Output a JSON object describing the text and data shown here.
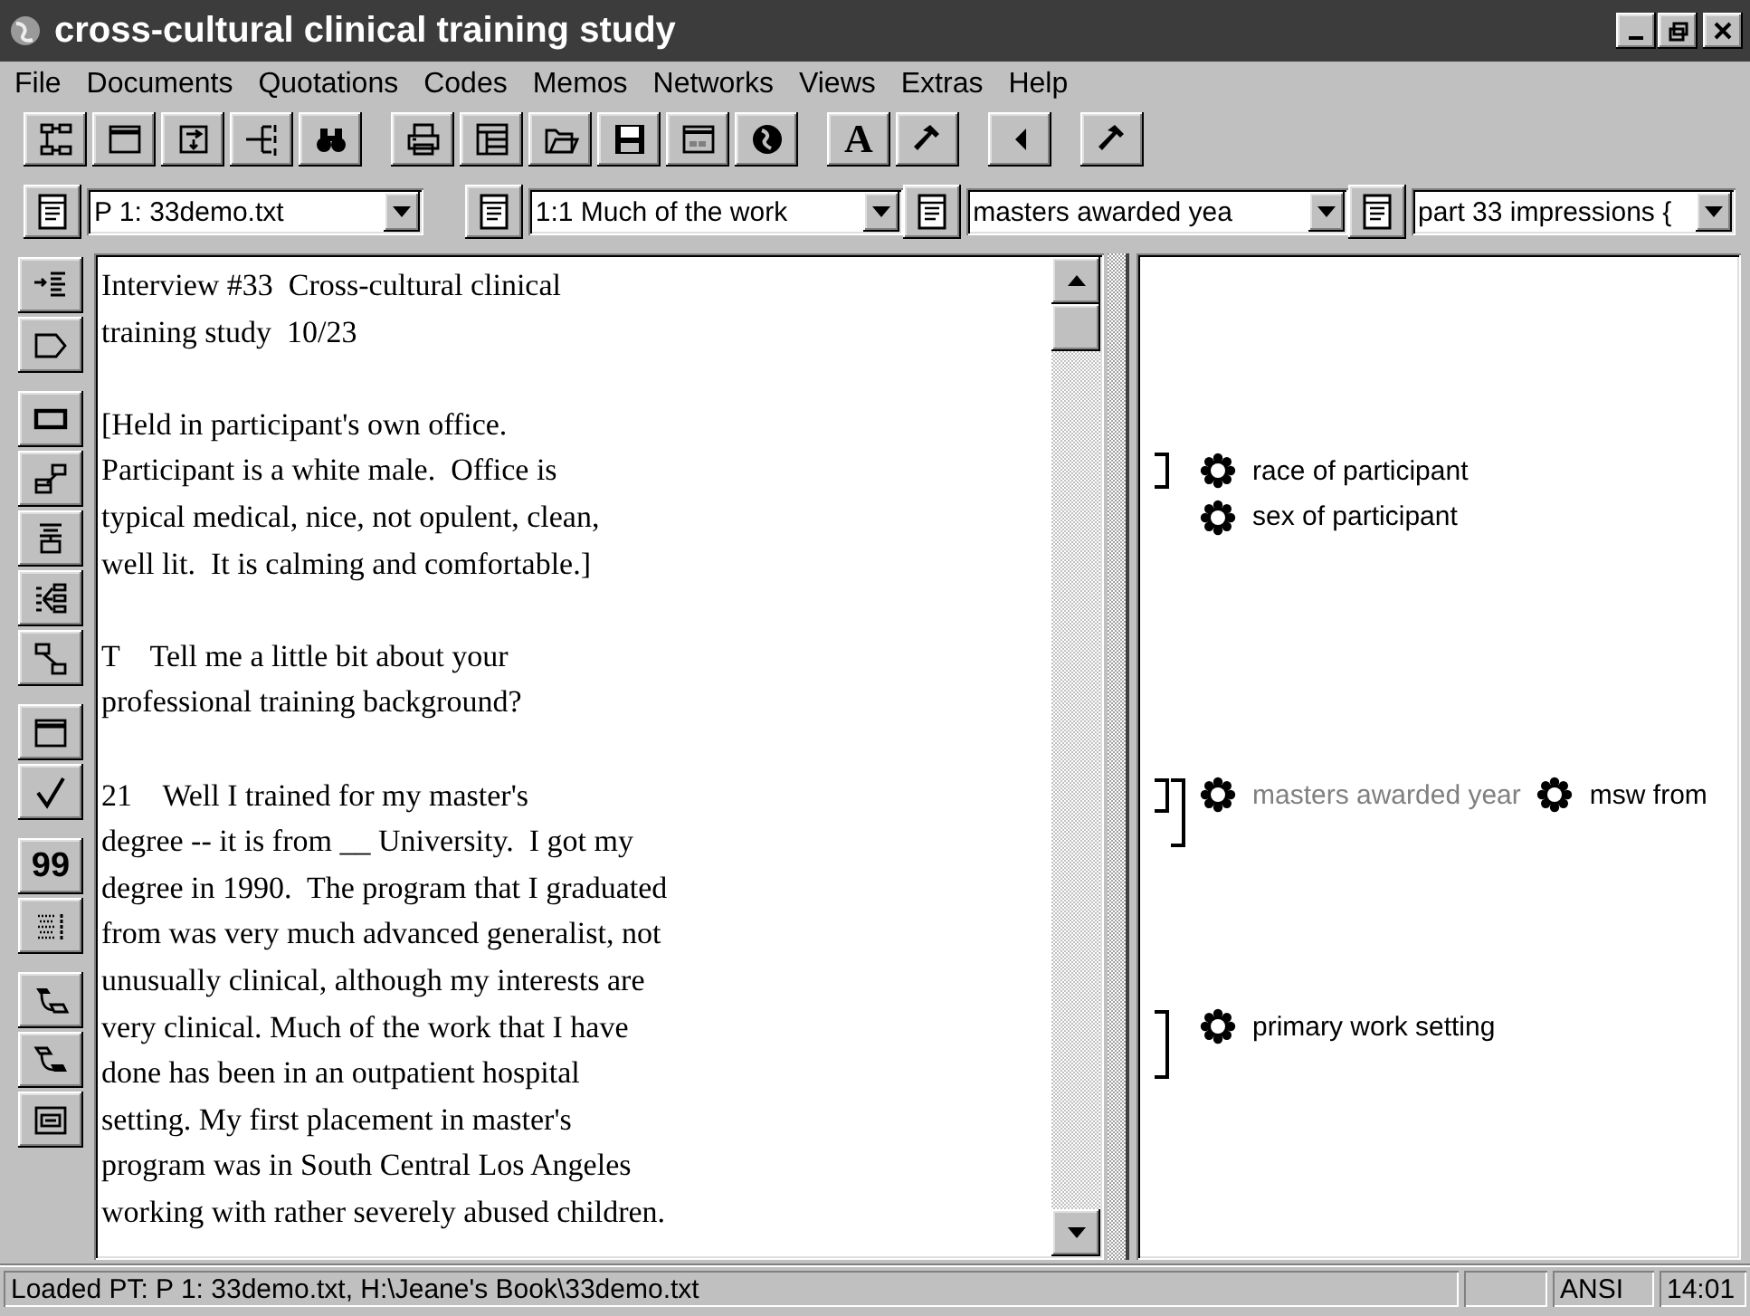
{
  "window": {
    "title": "cross-cultural clinical training study"
  },
  "menu": [
    "File",
    "Documents",
    "Quotations",
    "Codes",
    "Memos",
    "Networks",
    "Views",
    "Extras",
    "Help"
  ],
  "toolbar": [
    [
      {
        "kind": "hierarchy"
      },
      {
        "kind": "window"
      },
      {
        "kind": "import"
      },
      {
        "kind": "branch"
      },
      {
        "kind": "binoculars"
      }
    ],
    [
      {
        "kind": "printer"
      },
      {
        "kind": "table"
      },
      {
        "kind": "folder"
      },
      {
        "kind": "floppy"
      },
      {
        "kind": "panel"
      },
      {
        "kind": "globe"
      }
    ],
    [
      {
        "kind": "text",
        "text": "A"
      },
      {
        "kind": "hammer"
      }
    ],
    [
      {
        "kind": "caret"
      }
    ],
    [
      {
        "kind": "hammer"
      }
    ]
  ],
  "selectors": [
    {
      "value": "P 1: 33demo.txt"
    },
    {
      "value": "1:1 Much of the work"
    },
    {
      "value": "masters awarded yea"
    },
    {
      "value": "part 33 impressions {"
    }
  ],
  "side_toolbar": [
    [
      {
        "kind": "indent"
      },
      {
        "kind": "tag"
      }
    ],
    [
      {
        "kind": "rect"
      },
      {
        "kind": "editbox"
      },
      {
        "kind": "align"
      },
      {
        "kind": "network"
      },
      {
        "kind": "connector"
      }
    ],
    [
      {
        "kind": "window"
      },
      {
        "kind": "check"
      }
    ],
    [
      {
        "kind": "text",
        "text": "99"
      },
      {
        "kind": "textlines"
      }
    ],
    [
      {
        "kind": "link"
      },
      {
        "kind": "link2"
      },
      {
        "kind": "frame"
      }
    ]
  ],
  "document": {
    "paragraphs": [
      {
        "lines": [
          {
            "text": "Interview #33  Cross-cultural clinical"
          },
          {
            "text": "training study  10/23"
          }
        ]
      },
      {
        "lines": [
          {
            "text": "[Held in participant's own office."
          },
          {
            "text": "Participant is a white male.  Office is",
            "brackets": [
              {
                "shown": true,
                "opens": true,
                "closes": true
              }
            ],
            "codes": [
              {
                "label": "race of participant",
                "muted": false
              }
            ]
          },
          {
            "text": "typical medical, nice, not opulent, clean,",
            "codes": [
              {
                "label": "sex of participant",
                "muted": false
              }
            ]
          },
          {
            "text": "well lit.  It is calming and comfortable.]"
          }
        ]
      },
      {
        "lines": [
          {
            "text": "T    Tell me a little bit about your"
          },
          {
            "text": "professional training background?"
          }
        ]
      },
      {
        "lines": [
          {
            "text": "21    Well I trained for my master's",
            "brackets": [
              {
                "shown": true,
                "opens": true,
                "closes": true
              },
              {
                "shown": true,
                "opens": true,
                "closes": false
              }
            ],
            "codes": [
              {
                "label": "masters awarded year",
                "muted": true
              },
              {
                "label": "msw from",
                "muted": false
              }
            ]
          },
          {
            "text": "degree -- it is from __ University.  I got my",
            "brackets": [
              {
                "shown": false
              },
              {
                "shown": true,
                "opens": false,
                "closes": true
              }
            ]
          },
          {
            "text": "degree in 1990.  The program that I graduated"
          },
          {
            "text": "from was very much advanced generalist, not"
          },
          {
            "text": "unusually clinical, although my interests are"
          },
          {
            "text": "very clinical. Much of the work that I have",
            "brackets": [
              {
                "shown": true,
                "opens": true,
                "closes": false
              }
            ],
            "codes": [
              {
                "label": "primary work setting",
                "muted": false
              }
            ]
          },
          {
            "text": "done has been in an outpatient hospital",
            "brackets": [
              {
                "shown": true,
                "opens": false,
                "closes": true
              }
            ]
          },
          {
            "text": "setting. My first placement in master's"
          },
          {
            "text": "program was in South Central Los Angeles"
          },
          {
            "text": "working with rather severely abused children."
          }
        ]
      }
    ]
  },
  "status_bar": {
    "message": "Loaded PT: P 1: 33demo.txt, H:\\Jeane's Book\\33demo.txt",
    "encoding": "ANSI",
    "time": "14:01"
  }
}
